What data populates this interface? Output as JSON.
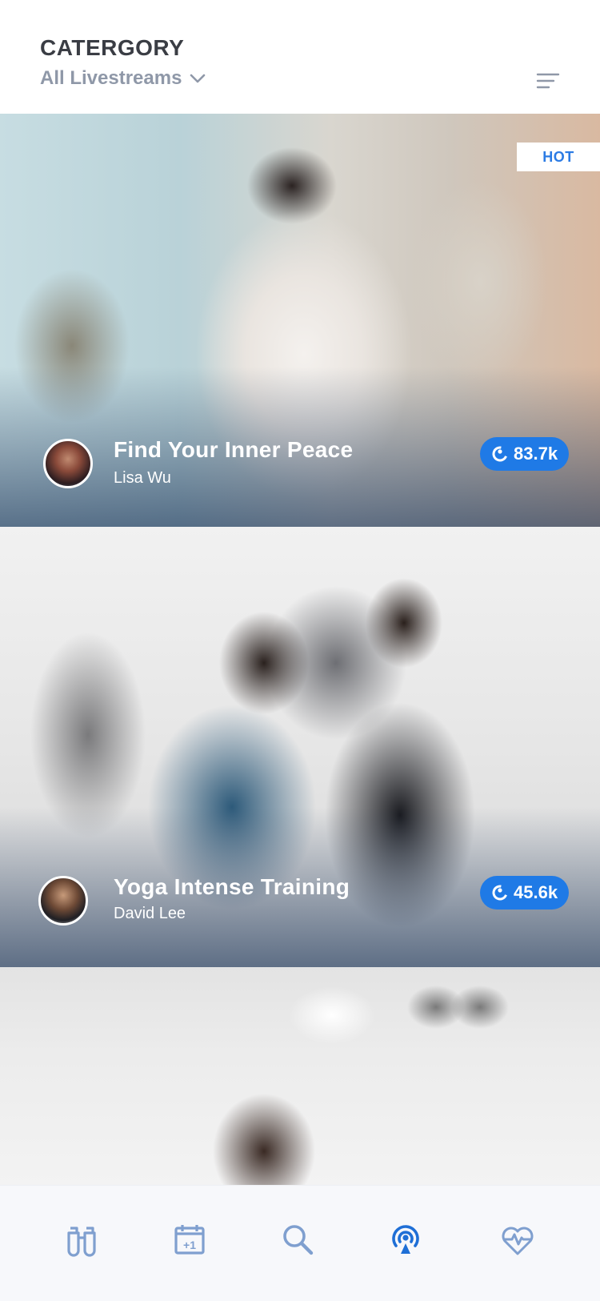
{
  "header": {
    "title": "CATERGORY",
    "category_value": "All Livestreams"
  },
  "feed": {
    "items": [
      {
        "badge": "HOT",
        "title": "Find Your Inner Peace",
        "author": "Lisa Wu",
        "viewers": "83.7k"
      },
      {
        "title": "Yoga Intense Training",
        "author": "David Lee",
        "viewers": "45.6k"
      },
      {
        "title": "",
        "author": ""
      }
    ]
  },
  "tabbar": {
    "icons": [
      "binoculars-icon",
      "calendar-plus-one-icon",
      "search-icon",
      "livestream-icon",
      "heart-rate-icon"
    ],
    "active": "livestream-icon",
    "colors": {
      "active": "#1f6fd6",
      "inactive": "#7f9fcf"
    }
  },
  "colors": {
    "accent": "#1f7ae6",
    "title": "#3a3d44",
    "subtitle": "#8f98a8"
  }
}
